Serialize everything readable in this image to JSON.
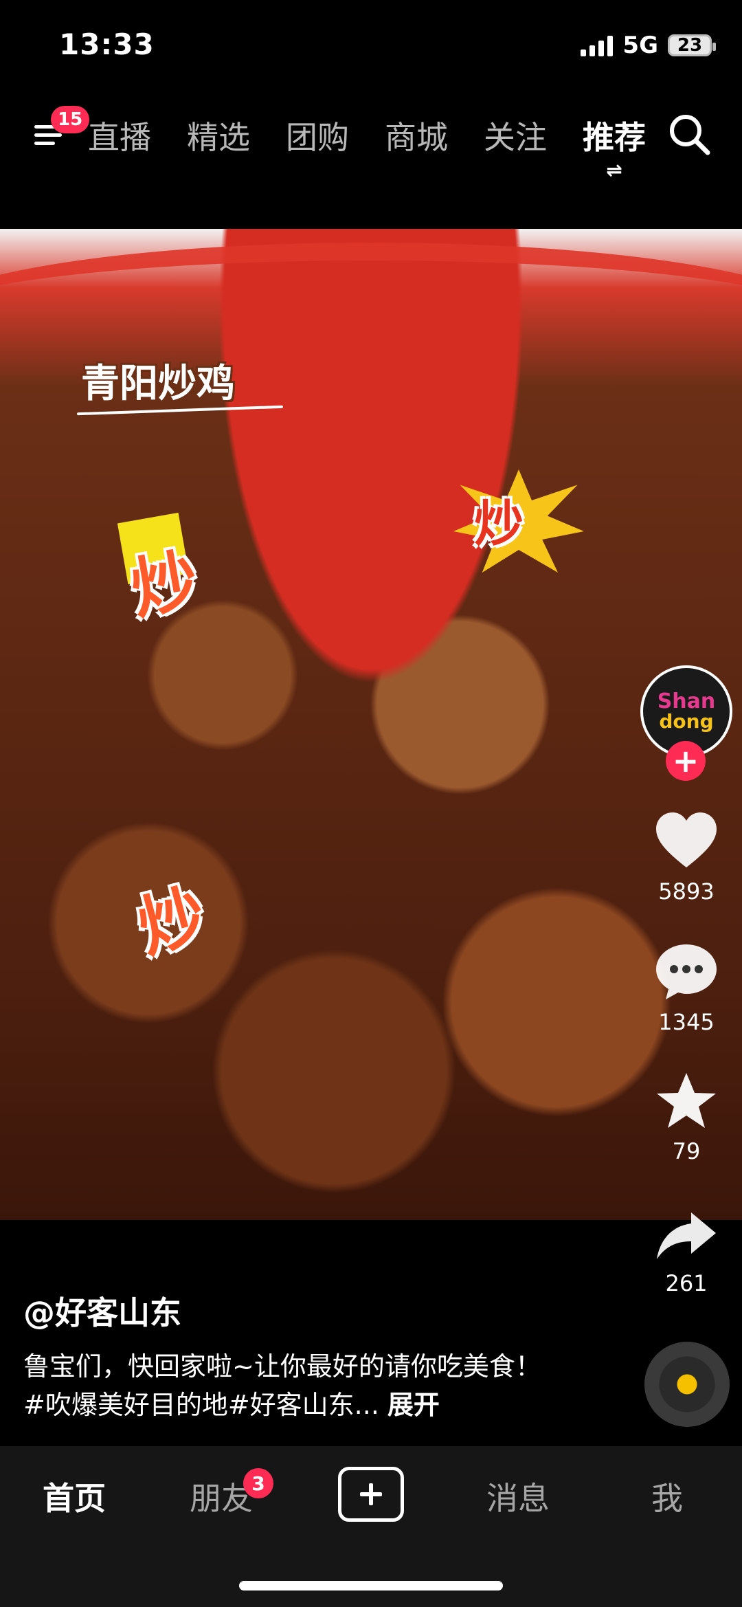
{
  "status_bar": {
    "time": "13:33",
    "network": "5G",
    "battery": "23"
  },
  "top_nav": {
    "menu_badge": "15",
    "tabs": [
      "直播",
      "精选",
      "团购",
      "商城",
      "关注",
      "推荐"
    ],
    "active_tab": "推荐"
  },
  "video": {
    "overlay_title": "青阳炒鸡",
    "stickers": [
      "炒",
      "炒",
      "炒"
    ]
  },
  "creator": {
    "avatar_text_1": "Shan",
    "avatar_text_2": "dong"
  },
  "actions": {
    "likes": "5893",
    "comments": "1345",
    "favorites": "79",
    "shares": "261"
  },
  "caption": {
    "author": "@好客山东",
    "text": "鲁宝们，快回家啦~让你最好的请你吃美食！#吹爆美好目的地#好客山东...",
    "expand_label": "展开"
  },
  "bottom_nav": {
    "items": [
      "首页",
      "朋友",
      "消息",
      "我"
    ],
    "friends_badge": "3"
  },
  "colors": {
    "accent": "#fe2c55",
    "background": "#000000",
    "bottom_bar": "#161616"
  }
}
